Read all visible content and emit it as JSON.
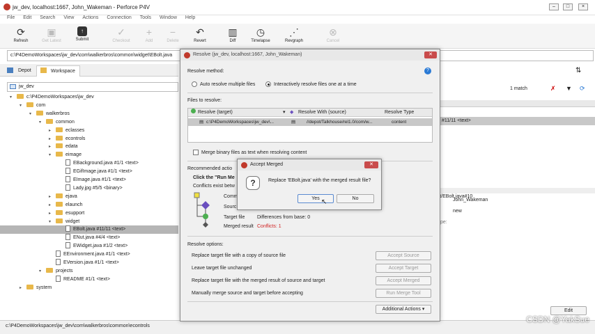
{
  "window": {
    "title": "jw_dev,  localhost:1667,  John_Wakeman - Perforce P4V"
  },
  "menu": [
    "File",
    "Edit",
    "Search",
    "View",
    "Actions",
    "Connection",
    "Tools",
    "Window",
    "Help"
  ],
  "toolbar": [
    {
      "label": "Refresh",
      "icon": "refresh-icon",
      "enabled": true
    },
    {
      "label": "Get Latest",
      "icon": "get-latest-icon",
      "enabled": false
    },
    {
      "label": "Submit",
      "icon": "submit-icon",
      "enabled": true
    },
    {
      "label": "Checkout",
      "icon": "checkout-icon",
      "enabled": false
    },
    {
      "label": "Add",
      "icon": "add-icon",
      "enabled": false
    },
    {
      "label": "Delete",
      "icon": "delete-icon",
      "enabled": false
    },
    {
      "label": "Revert",
      "icon": "revert-icon",
      "enabled": true
    },
    {
      "label": "Diff",
      "icon": "diff-icon",
      "enabled": true
    },
    {
      "label": "Timelapse",
      "icon": "timelapse-icon",
      "enabled": true
    },
    {
      "label": "Revgraph",
      "icon": "revgraph-icon",
      "enabled": true
    },
    {
      "label": "Cancel",
      "icon": "cancel-icon",
      "enabled": false
    }
  ],
  "path": "c:\\P4DemoWorkspaces\\jw_dev\\com\\walkerbros\\common\\widget\\EBolt.java",
  "tabs": {
    "depot": "Depot",
    "workspace": "Workspace"
  },
  "workspace_name": "jw_dev",
  "tree": [
    {
      "label": "c:\\P4DemoWorkspaces\\jw_dev",
      "depth": 0,
      "type": "folder",
      "arrow": "▾"
    },
    {
      "label": "com",
      "depth": 1,
      "type": "folder",
      "arrow": "▾"
    },
    {
      "label": "walkerbros",
      "depth": 2,
      "type": "folder",
      "arrow": "▾"
    },
    {
      "label": "common",
      "depth": 3,
      "type": "folder",
      "arrow": "▾"
    },
    {
      "label": "eclasses",
      "depth": 4,
      "type": "folder",
      "arrow": "▸"
    },
    {
      "label": "econtrols",
      "depth": 4,
      "type": "folder",
      "arrow": "▸"
    },
    {
      "label": "edata",
      "depth": 4,
      "type": "folder",
      "arrow": "▸"
    },
    {
      "label": "eimage",
      "depth": 4,
      "type": "folder",
      "arrow": "▾"
    },
    {
      "label": "EBackground.java #1/1 <text>",
      "depth": 5,
      "type": "file"
    },
    {
      "label": "EGifImage.java #1/1 <text>",
      "depth": 5,
      "type": "file"
    },
    {
      "label": "EImage.java #1/1 <text>",
      "depth": 5,
      "type": "file"
    },
    {
      "label": "Lady.jpg #5/5 <binary>",
      "depth": 5,
      "type": "file"
    },
    {
      "label": "ejava",
      "depth": 4,
      "type": "folder",
      "arrow": "▸"
    },
    {
      "label": "elaunch",
      "depth": 4,
      "type": "folder",
      "arrow": "▸"
    },
    {
      "label": "esupport",
      "depth": 4,
      "type": "folder",
      "arrow": "▸"
    },
    {
      "label": "widget",
      "depth": 4,
      "type": "folder",
      "arrow": "▾"
    },
    {
      "label": "EBolt.java #11/11 <text>",
      "depth": 5,
      "type": "file",
      "selected": true
    },
    {
      "label": "ENut.java #4/4 <text>",
      "depth": 5,
      "type": "file"
    },
    {
      "label": "EWidget.java #1/2 <text>",
      "depth": 5,
      "type": "file"
    },
    {
      "label": "EEnvironment.java #1/1 <text>",
      "depth": 4,
      "type": "file"
    },
    {
      "label": "EVersion.java #1/1 <text>",
      "depth": 4,
      "type": "file"
    },
    {
      "label": "projects",
      "depth": 3,
      "type": "folder",
      "arrow": "▾"
    },
    {
      "label": "README #1/1 <text>",
      "depth": 4,
      "type": "file"
    },
    {
      "label": "system",
      "depth": 1,
      "type": "folder",
      "arrow": "▸"
    }
  ],
  "right": {
    "match": "1 match",
    "row_text": "#11/11 <text>",
    "user": "John_Wakeman",
    "status": "new",
    "type_partial": "pe:",
    "path_partial": "idget/EBolt.java#10",
    "edit_label": "Edit"
  },
  "status_path": "c:\\P4DemoWorkspaces\\jw_dev\\com\\walkerbros\\common\\econtrols",
  "resolve": {
    "title": "Resolve (jw_dev,  localhost:1667,  John_Wakeman)",
    "method_label": "Resolve method:",
    "auto": "Auto resolve multiple files",
    "interactive": "Interactively resolve files one at a time",
    "files_label": "Files to resolve:",
    "columns": [
      "Resolve (target)",
      "Resolve With (source)",
      "Resolve Type"
    ],
    "row": {
      "target": "c:\\P4DemoWorkspaces\\jw_dev\\...",
      "source": "//depot/Talkhouse/rel1.0/com/w...",
      "type": "content"
    },
    "merge_binary": "Merge binary files as text when resolving content",
    "recommended": "Recommended actio",
    "click_run": "Click the \"Run Me",
    "conflicts_exist": "Conflicts exist betw",
    "comm": "Comm",
    "source": "Sourc",
    "target_file": "Target file",
    "differences": "Differences from base: 0",
    "merged_result": "Merged result",
    "conflicts": "Conflicts: 1",
    "options_label": "Resolve options:",
    "options": [
      {
        "text": "Replace target file with a copy of source file",
        "button": "Accept Source"
      },
      {
        "text": "Leave target file unchanged",
        "button": "Accept Target"
      },
      {
        "text": "Replace target file with the merged result of source and target",
        "button": "Accept Merged"
      },
      {
        "text": "Manually merge source and target before accepting",
        "button": "Run Merge Tool"
      }
    ],
    "additional": "Additional Actions"
  },
  "accept": {
    "title": "Accept Merged",
    "question": "Replace 'EBolt.java' with the merged result file?",
    "yes": "Yes",
    "no": "No"
  },
  "watermark": "CSDN @YakSue",
  "colors": {
    "accent": "#2a7ad5",
    "conflict": "#d02020",
    "selected_row": "#c8c8c8",
    "title_close": "#c94b4b"
  }
}
